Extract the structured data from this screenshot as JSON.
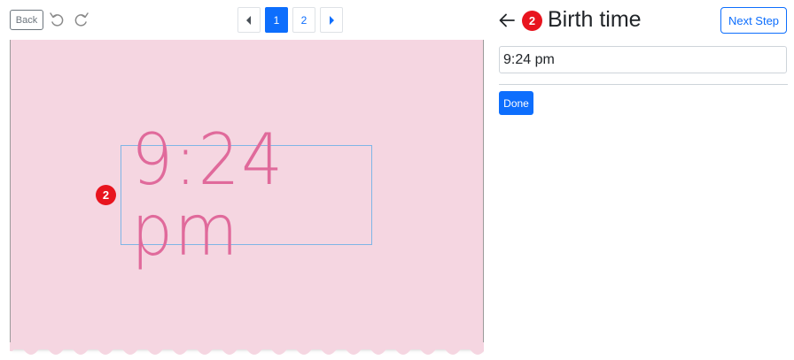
{
  "toolbar": {
    "back_label": "Back",
    "undo_icon": "undo-icon",
    "redo_icon": "redo-icon"
  },
  "pagination": {
    "prev_icon": "caret-left-icon",
    "pages": [
      "1",
      "2"
    ],
    "current_page": "1",
    "next_icon": "caret-right-icon"
  },
  "canvas": {
    "background_color": "#f5d6e1",
    "text": "9:24 pm",
    "text_color": "#e06a9b",
    "marker": "2"
  },
  "panel": {
    "back_icon": "arrow-left-icon",
    "step_badge": "2",
    "title": "Birth time",
    "next_label": "Next Step",
    "field_value": "9:24 pm",
    "done_label": "Done"
  },
  "colors": {
    "accent": "#0d6efd",
    "badge": "#e8141e"
  }
}
